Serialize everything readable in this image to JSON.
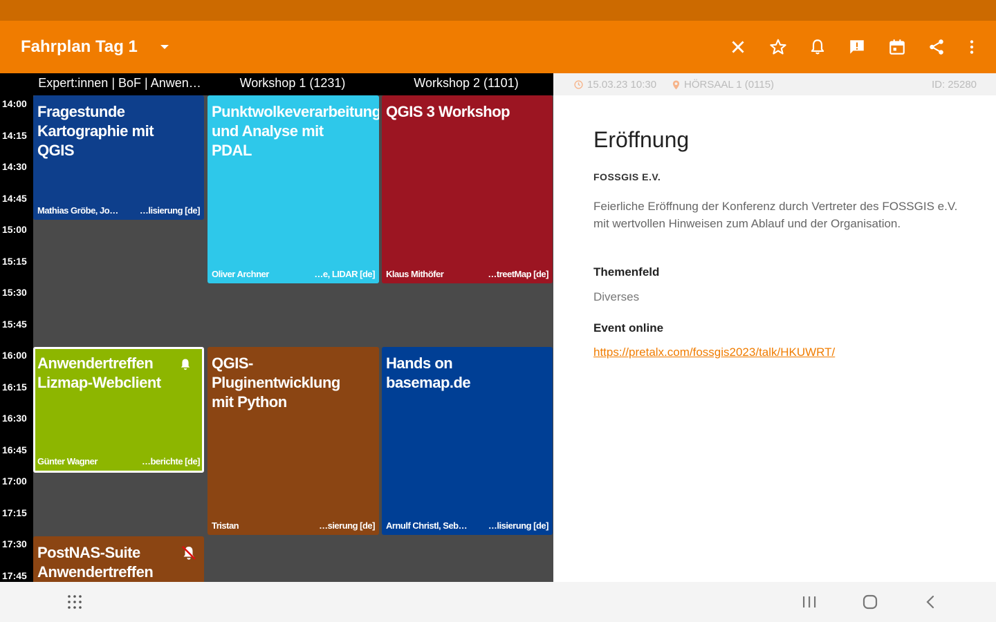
{
  "toolbar": {
    "title": "Fahrplan",
    "day": "Tag 1",
    "bg_color": "#f07c00",
    "icons": [
      "close-icon",
      "star-icon",
      "bell-icon",
      "feedback-icon",
      "calendar-icon",
      "share-icon",
      "more-vert-icon"
    ]
  },
  "schedule": {
    "columns": [
      "Expert:innen | BoF | Anwen…",
      "Workshop 1 (1231)",
      "Workshop 2 (1101)"
    ],
    "times": [
      "14:00",
      "14:15",
      "14:30",
      "14:45",
      "15:00",
      "15:15",
      "15:30",
      "15:45",
      "16:00",
      "16:15",
      "16:30",
      "16:45",
      "17:00",
      "17:15",
      "17:30",
      "17:45"
    ],
    "events": [
      {
        "title": "Fragestunde Kartographie mit QGIS",
        "speaker": "Mathias Gröbe, Jo…",
        "track": "…lisierung [de]",
        "color": "#0e3f8c"
      },
      {
        "title": "Punktwolkeverarbeitung und Analyse mit PDAL",
        "speaker": "Oliver Archner",
        "track": "…e, LIDAR [de]",
        "color": "#2ec8ea"
      },
      {
        "title": "QGIS 3 Workshop",
        "speaker": "Klaus Mithöfer",
        "track": "…treetMap [de]",
        "color": "#9c1522"
      },
      {
        "title": "Anwendertreffen Lizmap-Webclient",
        "speaker": "Günter Wagner",
        "track": "…berichte [de]",
        "color": "#8db600"
      },
      {
        "title": "QGIS-Pluginentwicklung mit Python",
        "speaker": "Tristan",
        "track": "…sierung [de]",
        "color": "#8b4513"
      },
      {
        "title": "Hands on basemap.de",
        "speaker": "Arnulf Christl, Seb…",
        "track": "…lisierung [de]",
        "color": "#003f95"
      },
      {
        "title": "PostNAS-Suite Anwendertreffen",
        "speaker": "",
        "track": "",
        "color": "#8b4513"
      }
    ]
  },
  "detail": {
    "date": "15.03.23 10:30",
    "room": "HÖRSAAL 1 (0115)",
    "id": "ID: 25280",
    "title": "Eröffnung",
    "speaker": "FOSSGIS E.V.",
    "abstract": "Feierliche Eröffnung der Konferenz durch Vertreter des FOSSGIS e.V. mit wertvollen Hinweisen zum Ablauf und der Organisation.",
    "topic_heading": "Themenfeld",
    "topic": "Diverses",
    "online_heading": "Event online",
    "link": "https://pretalx.com/fossgis2023/talk/HKUWRT/"
  },
  "navbar": {
    "icons": [
      "app-grid-icon",
      "recents-icon",
      "home-icon",
      "back-icon"
    ]
  }
}
